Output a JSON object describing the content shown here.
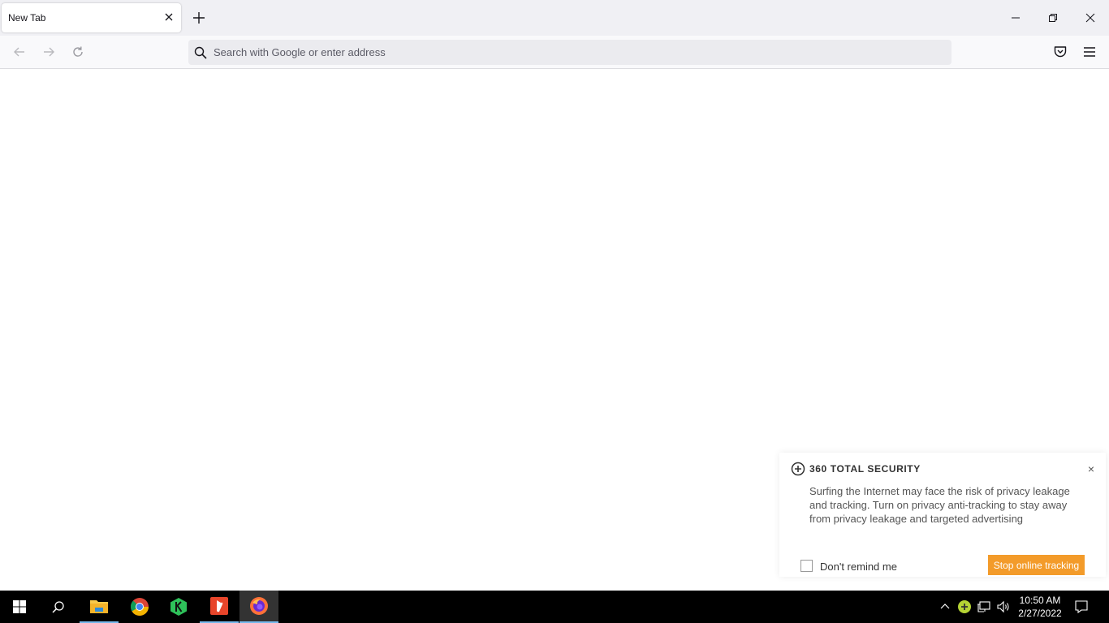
{
  "browser": {
    "tab": {
      "title": "New Tab"
    },
    "urlbar": {
      "placeholder": "Search with Google or enter address"
    }
  },
  "popup": {
    "title": "360 TOTAL SECURITY",
    "close": "×",
    "message": "Surfing the Internet may face the risk of privacy leakage and tracking. Turn on privacy anti-tracking to stay away from privacy leakage and targeted advertising",
    "checkbox_label": "Don't remind me",
    "cta_label": "Stop online tracking",
    "accent": "#f39b2a"
  },
  "taskbar": {
    "apps": [
      "file-explorer-icon",
      "chrome-icon",
      "kite-icon",
      "tablet-pro-icon",
      "firefox-icon"
    ],
    "clock": {
      "time": "10:50 AM",
      "date": "2/27/2022"
    }
  }
}
